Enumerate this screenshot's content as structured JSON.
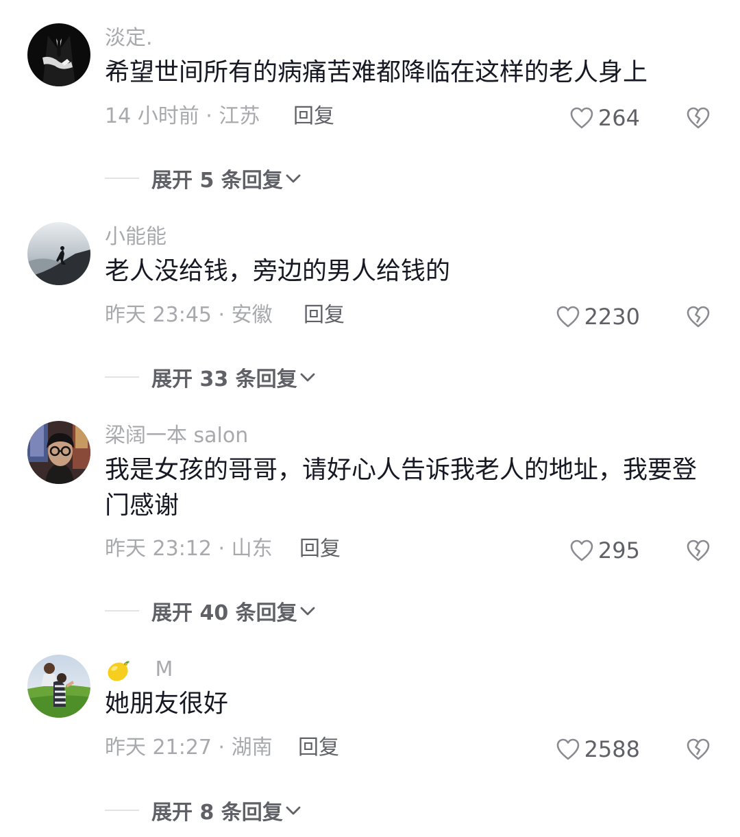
{
  "comments": [
    {
      "username": "淡定.",
      "text": "希望世间所有的病痛苦难都降临在这样的老人身上",
      "meta": "14 小时前 · 江苏",
      "reply_label": "回复",
      "likes": "264",
      "expand_label": "展开 5 条回复",
      "avatar_icon": "suit-man-avatar"
    },
    {
      "username": "小能能",
      "text": "老人没给钱，旁边的男人给钱的",
      "meta": "昨天 23:45 · 安徽",
      "reply_label": "回复",
      "likes": "2230",
      "expand_label": "展开 33 条回复",
      "avatar_icon": "mountain-silhouette-avatar"
    },
    {
      "username": "梁阔一本 salon",
      "text": "我是女孩的哥哥，请好心人告诉我老人的地址，我要登门感谢",
      "meta": "昨天 23:12 · 山东",
      "reply_label": "回复",
      "likes": "295",
      "expand_label": "展开 40 条回复",
      "avatar_icon": "man-with-glasses-avatar"
    },
    {
      "username": "M",
      "username_prefix_icon": "lemon-emoji",
      "text": "她朋友很好",
      "meta": "昨天 21:27 · 湖南",
      "reply_label": "回复",
      "likes": "2588",
      "expand_label": "展开 8 条回复",
      "avatar_icon": "grass-field-avatar"
    }
  ],
  "colors": {
    "text_primary": "#161823",
    "text_secondary": "#a8a9ad",
    "text_action": "#5f6167",
    "divider": "#e3e3e4"
  }
}
